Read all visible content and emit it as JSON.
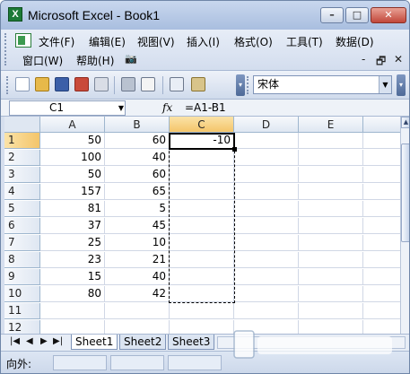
{
  "window": {
    "title": "Microsoft Excel - Book1",
    "min_glyph": "–",
    "max_glyph": "□",
    "close_glyph": "✕"
  },
  "menu": {
    "row1": [
      "文件(F)",
      "编辑(E)",
      "视图(V)",
      "插入(I)",
      "格式(O)",
      "工具(T)",
      "数据(D)"
    ],
    "row2": [
      "窗口(W)",
      "帮助(H)"
    ],
    "right_controls": [
      "-",
      "🗗",
      "✕"
    ]
  },
  "toolbar": {
    "icons": [
      "new-icon",
      "open-icon",
      "save-icon",
      "permission-icon",
      "email-icon",
      "print-icon",
      "print-preview-icon",
      "spelling-icon",
      "research-icon"
    ],
    "font_name": "宋体"
  },
  "formula_bar": {
    "name_box": "C1",
    "fx_label": "fx",
    "formula": "=A1-B1"
  },
  "sheet": {
    "columns": [
      "A",
      "B",
      "C",
      "D",
      "E"
    ],
    "active_column": "C",
    "active_row": "1",
    "rows": [
      {
        "row": "1",
        "A": "50",
        "B": "60",
        "C": "-10"
      },
      {
        "row": "2",
        "A": "100",
        "B": "40",
        "C": ""
      },
      {
        "row": "3",
        "A": "50",
        "B": "60",
        "C": ""
      },
      {
        "row": "4",
        "A": "157",
        "B": "65",
        "C": ""
      },
      {
        "row": "5",
        "A": "81",
        "B": "5",
        "C": ""
      },
      {
        "row": "6",
        "A": "37",
        "B": "45",
        "C": ""
      },
      {
        "row": "7",
        "A": "25",
        "B": "10",
        "C": ""
      },
      {
        "row": "8",
        "A": "23",
        "B": "21",
        "C": ""
      },
      {
        "row": "9",
        "A": "15",
        "B": "40",
        "C": ""
      },
      {
        "row": "10",
        "A": "80",
        "B": "42",
        "C": ""
      },
      {
        "row": "11",
        "A": "",
        "B": "",
        "C": ""
      },
      {
        "row": "12",
        "A": "",
        "B": "",
        "C": ""
      }
    ]
  },
  "tabs": {
    "nav": [
      "|◀",
      "◀",
      "▶",
      "▶|"
    ],
    "sheets": [
      "Sheet1",
      "Sheet2",
      "Sheet3"
    ],
    "active": "Sheet1"
  },
  "status": {
    "text": "向外:"
  },
  "colors": {
    "selection_header": "#f4c56a",
    "grid_line": "#d0d7e5"
  }
}
